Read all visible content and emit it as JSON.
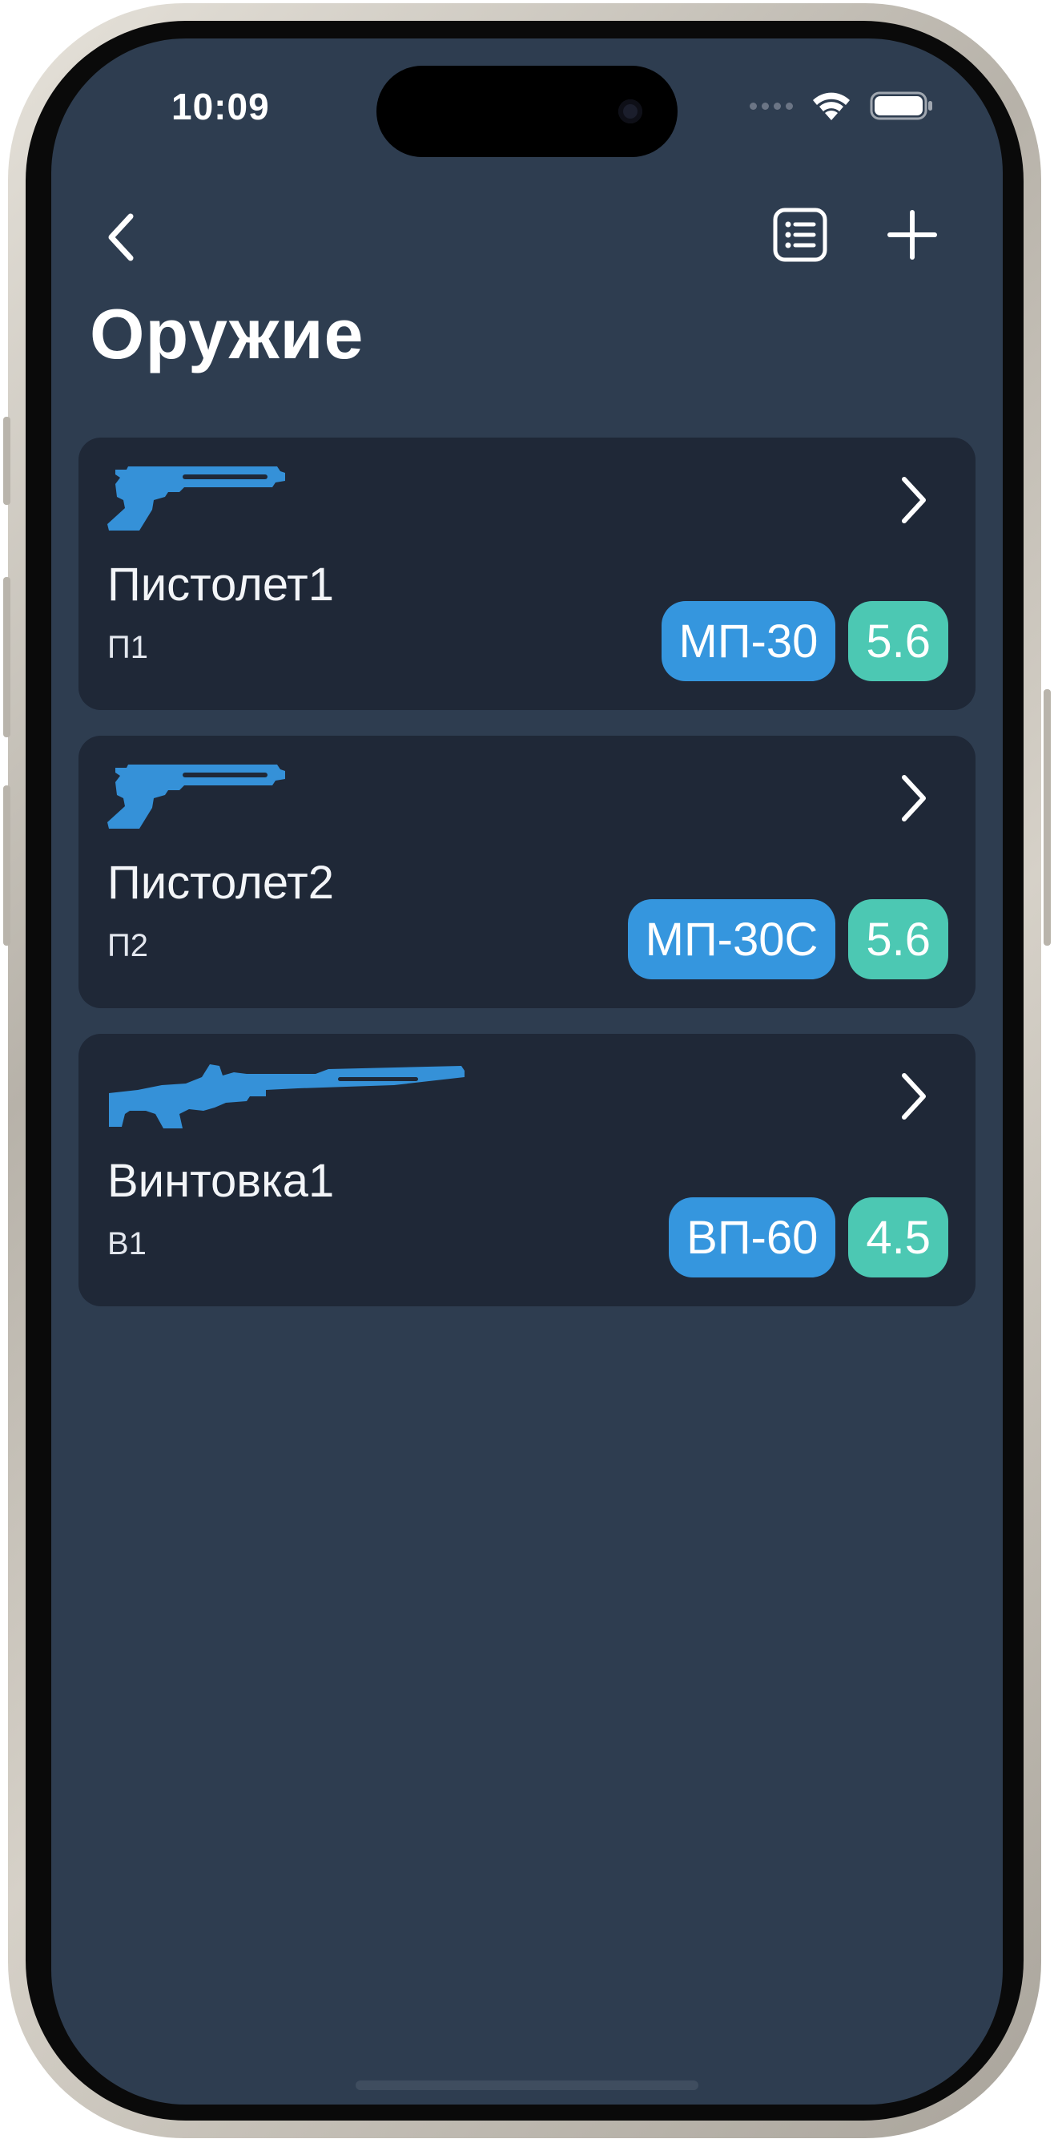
{
  "status_bar": {
    "time": "10:09"
  },
  "header": {
    "title": "Оружие"
  },
  "weapons": [
    {
      "name": "Пистолет1",
      "code": "П1",
      "model": "МП-30",
      "caliber": "5.6",
      "icon": "pistol-icon"
    },
    {
      "name": "Пистолет2",
      "code": "П2",
      "model": "МП-30С",
      "caliber": "5.6",
      "icon": "pistol-icon"
    },
    {
      "name": "Винтовка1",
      "code": "В1",
      "model": "ВП-60",
      "caliber": "4.5",
      "icon": "rifle-icon"
    }
  ],
  "colors": {
    "background": "#2e3d50",
    "card": "#1f2837",
    "model_badge": "#3596de",
    "caliber_badge": "#4cc8b3",
    "icon_accent": "#3591d8"
  }
}
